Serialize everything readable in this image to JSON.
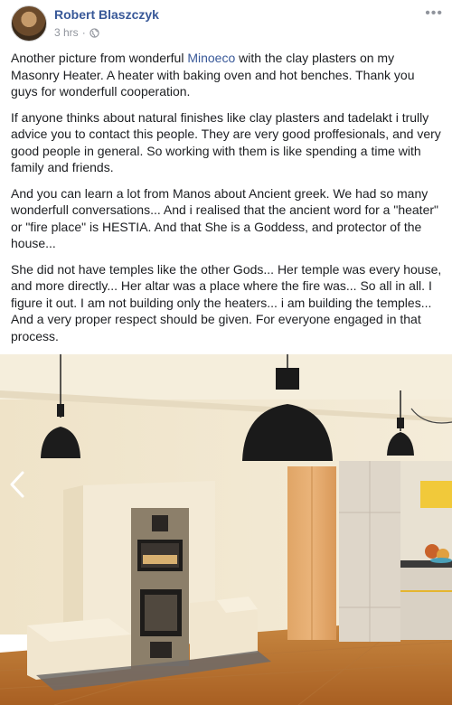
{
  "post": {
    "author": "Robert Blaszczyk",
    "time": "3 hrs",
    "separator": "·",
    "more_label": "•••",
    "paragraphs": {
      "p1_before": "Another picture from wonderful ",
      "p1_link": "Minoeco",
      "p1_after": " with the clay plasters on my Masonry Heater. A heater with baking oven and hot benches. Thank you guys for wonderfull cooperation.",
      "p2": "If anyone thinks about natural finishes like clay plasters and tadelakt i trully advice you to contact this people. They are very good proffesionals, and very good people in general. So working with them is like spending a time with family and friends.",
      "p3": "And you can learn a lot from Manos about Ancient greek. We had so many wonderfull conversations... And i realised that the ancient word for a \"heater\" or \"fire place\" is HESTIA. And that She is a Goddess, and protector of the house...",
      "p4": "She did not have temples like the other Gods... Her temple was every house, and more directly... Her altar was a place where the fire was... So all in all. I figure it out. I am not building only the heaters... i am building the temples... And a very proper respect should be given. For everyone engaged in that process."
    }
  },
  "colors": {
    "link": "#385898",
    "meta": "#90949c",
    "text": "#1c1e21"
  },
  "icons": {
    "globe": "globe-icon",
    "more": "more-options-icon",
    "prev": "chevron-left-icon"
  }
}
